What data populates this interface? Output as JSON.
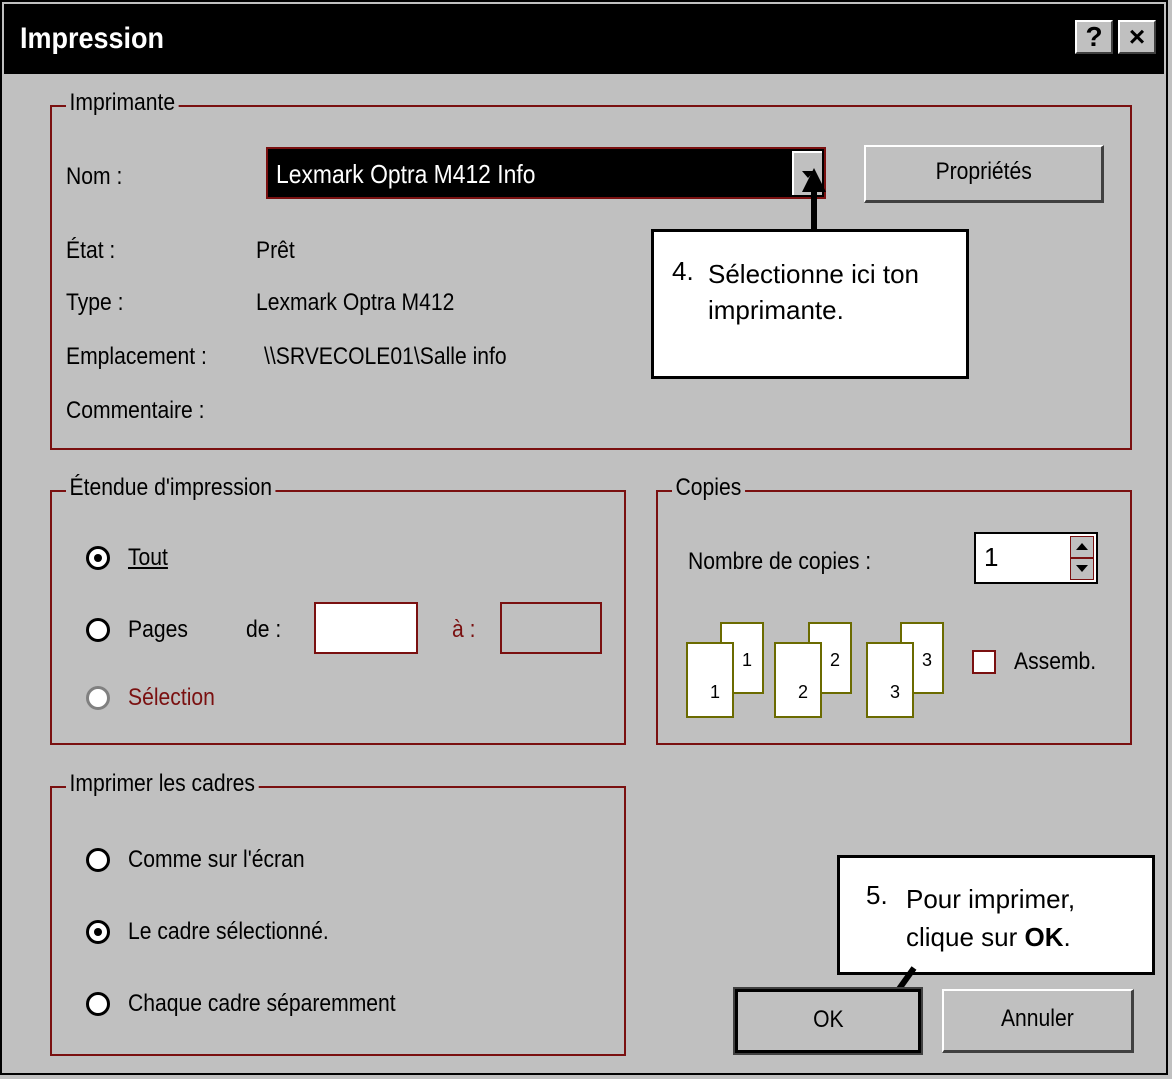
{
  "window": {
    "title": "Impression",
    "help_label": "?",
    "close_label": "×"
  },
  "printer": {
    "legend": "Imprimante",
    "name_label": "Nom :",
    "name_value": "Lexmark Optra M412 Info",
    "properties_label": "Propriétés",
    "status_label": "État :",
    "status_value": "Prêt",
    "type_label": "Type :",
    "type_value": "Lexmark Optra M412",
    "location_label": "Emplacement :",
    "location_value": "\\\\SRVECOLE01\\Salle info",
    "comment_label": "Commentaire :"
  },
  "range": {
    "legend": "Étendue d'impression",
    "all_label": "Tout",
    "pages_label": "Pages",
    "from_label": "de :",
    "to_label": "à :",
    "from_value": "",
    "to_value": "",
    "selection_label": "Sélection",
    "selected": "all"
  },
  "copies": {
    "legend": "Copies",
    "count_label": "Nombre de copies :",
    "count_value": "1",
    "collate_label": "Assemb.",
    "collate_checked": false,
    "pages": [
      "1",
      "2",
      "3"
    ]
  },
  "frames": {
    "legend": "Imprimer les cadres",
    "options": [
      "Comme sur l'écran",
      "Le cadre sélectionné.",
      "Chaque cadre séparemment"
    ],
    "selected_index": 1
  },
  "buttons": {
    "ok": "OK",
    "cancel": "Annuler"
  },
  "callouts": {
    "step4_number": "4.",
    "step4_text": "Sélectionne ici ton imprimante.",
    "step5_number": "5.",
    "step5_text_before": "Pour imprimer, clique sur ",
    "step5_bold": "OK",
    "step5_after": "."
  }
}
